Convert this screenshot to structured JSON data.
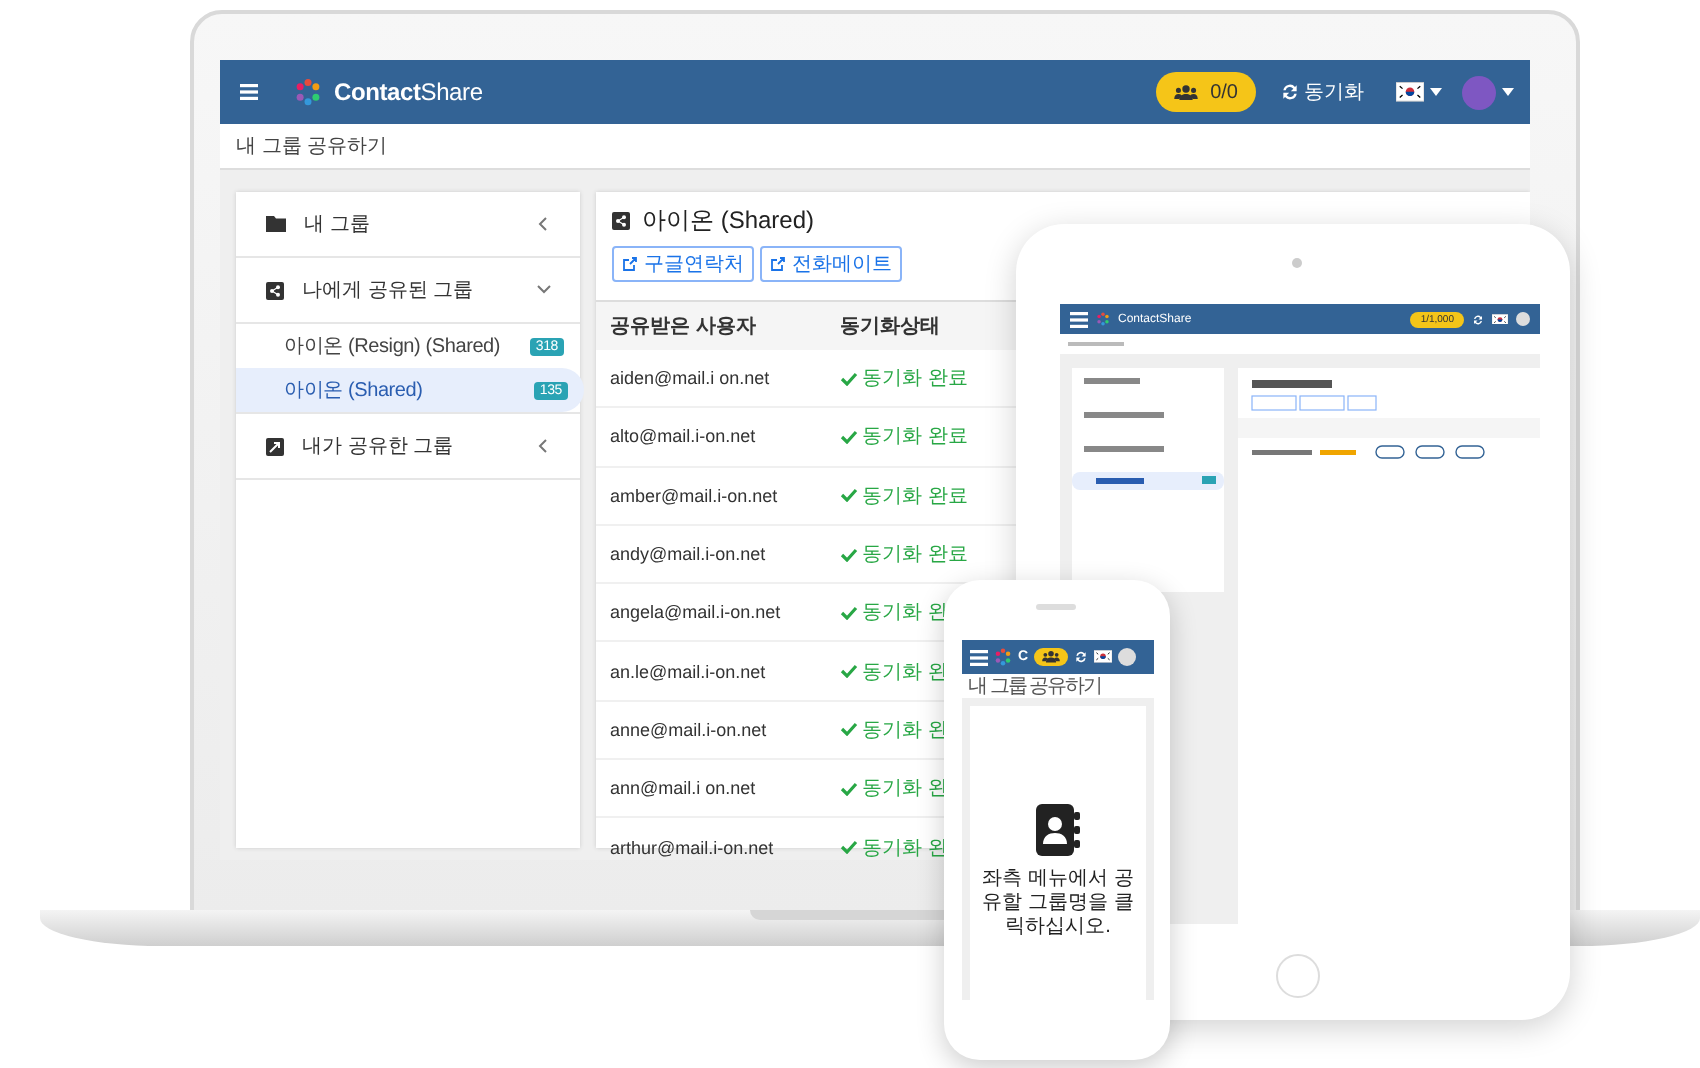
{
  "laptop": {
    "app_bar": {
      "logo": "**Contact**Share",
      "contacts_badge": "0/0",
      "sync_label": "동기화"
    },
    "breadcrumb": "내 그룹 공유하기",
    "sidebar": {
      "items": [
        {
          "label": "내 그룹",
          "kind": "folder",
          "expanded": false
        },
        {
          "label": "나에게 공유된 그룹",
          "kind": "received",
          "expanded": true,
          "children": [
            {
              "label": "아이온 (Resign) (Shared)",
              "count": "318",
              "selected": false
            },
            {
              "label": "아이온 (Shared)",
              "count": "135",
              "selected": true
            }
          ]
        },
        {
          "label": "내가 공유한 그룹",
          "kind": "sent",
          "expanded": false
        }
      ]
    },
    "main": {
      "title": "아이온 (Shared)",
      "buttons": [
        "구글연락처",
        "전화메이트"
      ],
      "table": {
        "columns": [
          "공유받은 사용자",
          "동기화상태"
        ],
        "rows": [
          {
            "user": "aiden@mail.i on.net",
            "status": "동기화 완료"
          },
          {
            "user": "alto@mail.i-on.net",
            "status": "동기화 완료"
          },
          {
            "user": "amber@mail.i-on.net",
            "status": "동기화 완료"
          },
          {
            "user": "andy@mail.i-on.net",
            "status": "동기화 완료"
          },
          {
            "user": "angela@mail.i-on.net",
            "status": "동기화 완"
          },
          {
            "user": "an.le@mail.i-on.net",
            "status": "동기화 완"
          },
          {
            "user": "anne@mail.i-on.net",
            "status": "동기화 완"
          },
          {
            "user": "ann@mail.i on.net",
            "status": "동기화 완"
          },
          {
            "user": "arthur@mail.i-on.net",
            "status": "동기화 완"
          }
        ]
      }
    }
  },
  "tablet": {
    "app_bar": {
      "logo": "ContactShare",
      "contacts_badge": "1/1,000"
    }
  },
  "phone": {
    "app_bar": {
      "logo": "C"
    },
    "breadcrumb": "내 그룹 공유하기",
    "message": "좌측 메뉴에서 공유할 그룹명을 클릭하십시오."
  }
}
